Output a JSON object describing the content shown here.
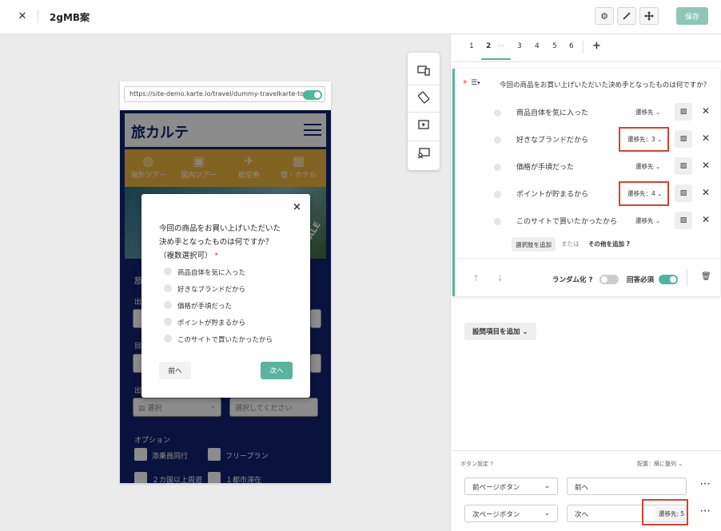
{
  "header": {
    "title": "2gMB案",
    "save_label": "保存",
    "icons": [
      "close-icon",
      "gear-icon",
      "magic-wand-icon",
      "move-icon"
    ]
  },
  "preview": {
    "url": "https://site-demo.karte.io/travel/dummy-travelkarte-top.h",
    "site_logo": "旅カルテ",
    "nav": [
      {
        "label": "海外ツアー",
        "icon": "globe-icon"
      },
      {
        "label": "国内ツアー",
        "icon": "suitcase-icon"
      },
      {
        "label": "航空券",
        "icon": "airplane-icon"
      },
      {
        "label": "宿・ホテル",
        "icon": "building-icon"
      }
    ],
    "hero_badge": "ALE",
    "side_labels": [
      "旅",
      "出",
      "目",
      "出"
    ],
    "field_select_placeholder": "選択",
    "field_select2_placeholder": "選択してください",
    "options_heading": "オプション",
    "checkboxes": [
      "添乗員同行",
      "フリープラン",
      "２カ国以上周遊",
      "１都市滞在"
    ]
  },
  "modal": {
    "question_line1": "今回の商品をお買い上げいただいた",
    "question_line2": "決め手となったものは何ですか？",
    "question_line3": "（複数選択可）",
    "required_mark": "*",
    "options": [
      "商品自体を気に入った",
      "好きなブランドだから",
      "価格が手頃だった",
      "ポイントが貯まるから",
      "このサイトで買いたかったから"
    ],
    "prev_label": "前へ",
    "next_label": "次へ",
    "close_glyph": "×"
  },
  "tabs": [
    "1",
    "2",
    "···",
    "3",
    "4",
    "5",
    "6",
    "+"
  ],
  "question": {
    "required_mark": "*",
    "text": "今回の商品をお買い上げいただいた決め手となったものは何ですか？",
    "options": [
      {
        "label": "商品自体を気に入った",
        "transition": "遷移先"
      },
      {
        "label": "好きなブランドだから",
        "transition": "遷移先：3"
      },
      {
        "label": "価格が手頃だった",
        "transition": "遷移先"
      },
      {
        "label": "ポイントが貯まるから",
        "transition": "遷移先：4"
      },
      {
        "label": "このサイトで買いたかったから",
        "transition": "遷移先"
      }
    ],
    "add_option_label": "選択肢を追加",
    "or_label": "または",
    "add_other_label": "その他を追加",
    "randomize_label": "ランダム化",
    "required_label": "回答必須",
    "randomize_on": false,
    "required_on": true
  },
  "add_question_label": "設問項目を追加",
  "button_settings": {
    "label": "ボタン設定",
    "layout_label": "配置：",
    "layout_value": "横に整列",
    "rows": [
      {
        "type": "前ページボタン",
        "text": "前へ",
        "transition": ""
      },
      {
        "type": "次ページボタン",
        "text": "次へ",
        "transition": "遷移先: 5"
      }
    ]
  },
  "colors": {
    "accent": "#59b39e",
    "highlight": "#d9422c",
    "site_navy": "#122370",
    "site_orange": "#efb53c"
  }
}
